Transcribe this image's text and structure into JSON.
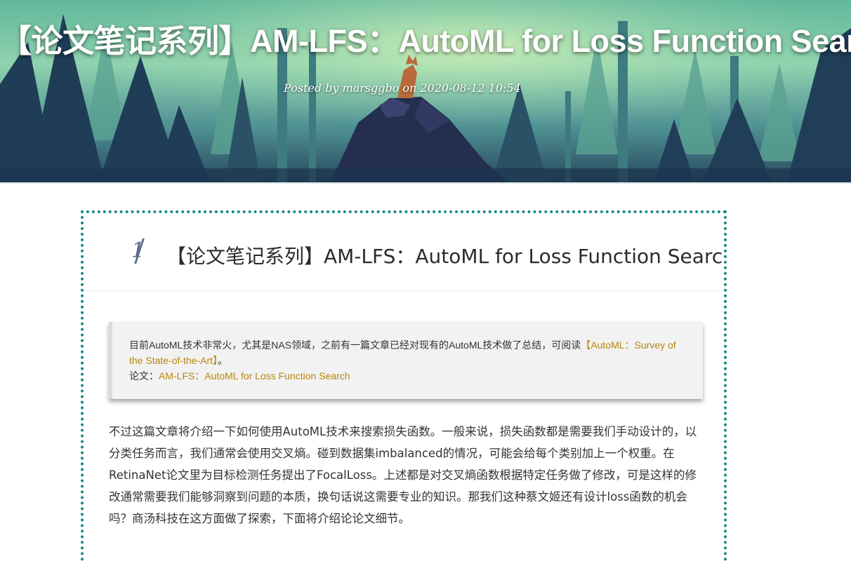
{
  "header": {
    "title": "【论文笔记系列】AM-LFS：AutoML for Loss Function Search",
    "posted_by_label": "Posted by",
    "author": "marsggbo",
    "on_label": "on",
    "datetime": "2020-08-12 10:54"
  },
  "toc": {
    "number": "1",
    "heading": "【论文笔记系列】AM-LFS：AutoML for Loss Function Search"
  },
  "intro_quote": {
    "text": "目前AutoML技术非常火，尤其是NAS领域，之前有一篇文章已经对现有的AutoML技术做了总结，可阅读",
    "survey_link": "【AutoML：Survey of the State-of-the-Art】",
    "end_mark": "。",
    "paper_label": "论文：",
    "paper_link": "AM-LFS：AutoML for Loss Function Search"
  },
  "body": {
    "paragraph": "不过这篇文章将介绍一下如何使用AutoML技术来搜索损失函数。一般来说，损失函数都是需要我们手动设计的，以分类任务而言，我们通常会使用交叉熵。碰到数据集imbalanced的情况，可能会给每个类别加上一个权重。在RetinaNet论文里为目标检测任务提出了FocalLoss。上述都是对交叉熵函数根据特定任务做了修改，可是这样的修改通常需要我们能够洞察到问题的本质，换句话说这需要专业的知识。那我们这种蔡文姬还有设计loss函数的机会吗？商汤科技在这方面做了探索，下面将介绍论论文细节。"
  },
  "colors": {
    "link": "#b8860b",
    "card_border": "#138a88",
    "toc_number": "#5b6a92"
  }
}
